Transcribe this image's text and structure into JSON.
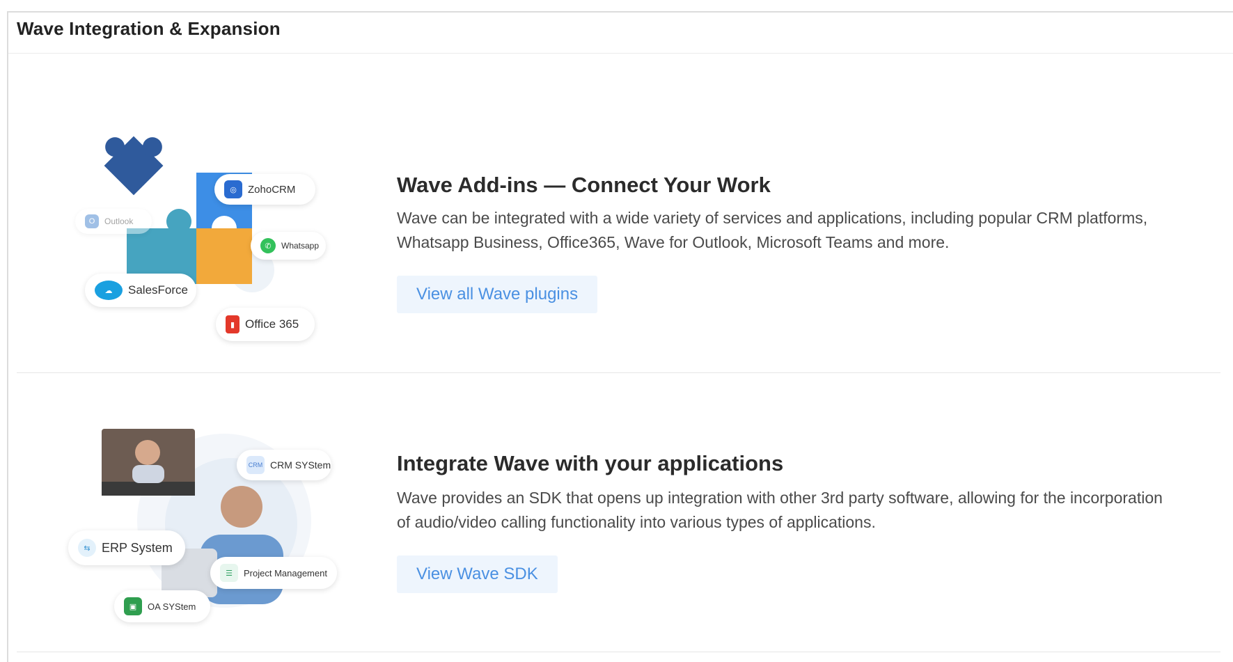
{
  "panel": {
    "title": "Wave Integration & Expansion"
  },
  "sections": [
    {
      "title": "Wave Add-ins — Connect Your Work",
      "description": "Wave can be integrated with a wide variety of services and applications, including popular CRM platforms, Whatsapp Business, Office365, Wave for Outlook, Microsoft Teams and more.",
      "button_label": "View all Wave plugins",
      "illustration_labels": [
        "ZohoCRM",
        "Outlook",
        "Whatsapp",
        "SalesForce",
        "Office 365"
      ]
    },
    {
      "title": "Integrate Wave with your applications",
      "description": "Wave provides an SDK that opens up integration with other 3rd party software, allowing for the incorporation of audio/video calling functionality into various types of applications.",
      "button_label": "View Wave SDK",
      "illustration_labels": [
        "CRM SYStem",
        "ERP System",
        "Project Management",
        "OA SYStem"
      ]
    }
  ],
  "colors": {
    "accent_text": "#4a90e2",
    "button_bg": "#eef5fd",
    "puzzle_navy": "#2f5a9c",
    "puzzle_blue": "#3d8ee6",
    "puzzle_teal": "#46a4c0",
    "puzzle_orange": "#f2a93b"
  },
  "icons": [
    "puzzle-illustration",
    "zohocrm-icon",
    "outlook-icon",
    "whatsapp-icon",
    "salesforce-icon",
    "office365-icon",
    "video-call-illustration",
    "crm-icon",
    "erp-icon",
    "project-management-icon",
    "oa-icon"
  ]
}
